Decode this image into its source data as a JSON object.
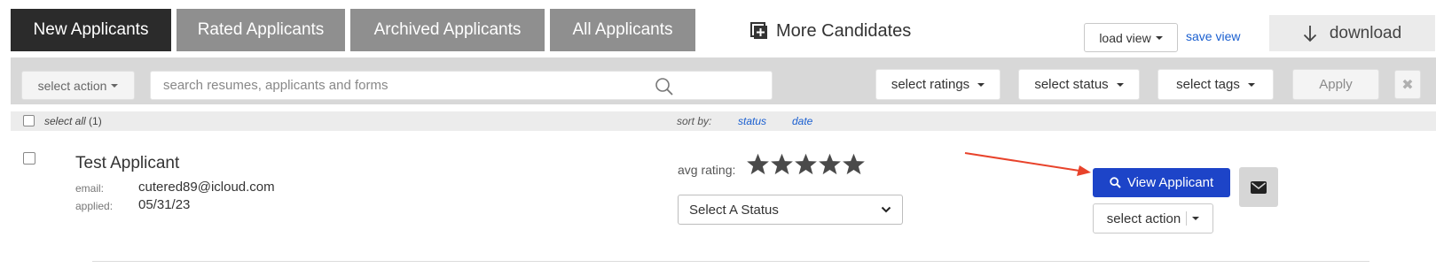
{
  "tabs": [
    {
      "label": "New Applicants",
      "active": true
    },
    {
      "label": "Rated Applicants",
      "active": false
    },
    {
      "label": "Archived Applicants",
      "active": false
    },
    {
      "label": "All Applicants",
      "active": false
    }
  ],
  "more_candidates": {
    "label": "More Candidates",
    "icon": "plus-square-icon"
  },
  "view_controls": {
    "load_view": "load view",
    "save_view": "save view",
    "download": "download"
  },
  "filters": {
    "select_action": "select action",
    "search_placeholder": "search resumes, applicants and forms",
    "select_ratings": "select ratings",
    "select_status": "select status",
    "select_tags": "select tags",
    "apply": "Apply",
    "clear_icon": "close-icon"
  },
  "sort_row": {
    "select_all": "select all",
    "count": "(1)",
    "sort_by": "sort by:",
    "sort_options": [
      "status",
      "date"
    ]
  },
  "applicant": {
    "name": "Test Applicant",
    "email_label": "email:",
    "email": "cutered89@icloud.com",
    "applied_label": "applied:",
    "applied": "05/31/23",
    "avg_rating_label": "avg rating:",
    "rating_stars": 5,
    "rating_value": 0,
    "status_placeholder": "Select A Status",
    "view_button": "View Applicant",
    "action_button": "select action",
    "mail_icon": "envelope-icon"
  },
  "colors": {
    "active_tab": "#2b2b2b",
    "tab": "#8f8f8f",
    "primary": "#1d44c8",
    "link": "#1a5fd0",
    "annotation_arrow": "#e8432b"
  }
}
